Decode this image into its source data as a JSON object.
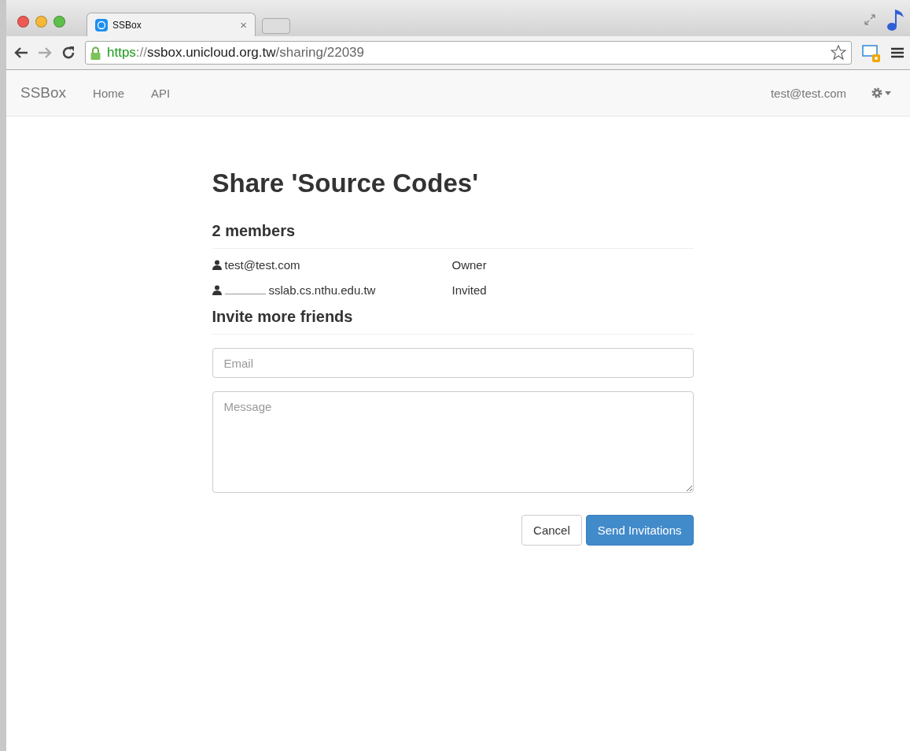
{
  "browser": {
    "tab": {
      "title": "SSBox",
      "close": "×"
    },
    "url": {
      "scheme": "https",
      "separator": "://",
      "host": "ssbox.unicloud.org.tw",
      "path": "/sharing/22039",
      "secure": true
    }
  },
  "navbar": {
    "brand": "SSBox",
    "links": [
      "Home",
      "API"
    ],
    "user": "test@test.com"
  },
  "page": {
    "title": "Share 'Source Codes'",
    "members_heading": "2 members",
    "members": [
      {
        "email": "test@test.com",
        "role": "Owner",
        "redacted": false
      },
      {
        "email": "sslab.cs.nthu.edu.tw",
        "role": "Invited",
        "redacted": true
      }
    ],
    "invite_heading": "Invite more friends",
    "email_field": {
      "placeholder": "Email"
    },
    "message_field": {
      "placeholder": "Message"
    },
    "buttons": [
      {
        "label": "Cancel",
        "kind": "default"
      },
      {
        "label": "Send Invitations",
        "kind": "primary"
      }
    ]
  }
}
